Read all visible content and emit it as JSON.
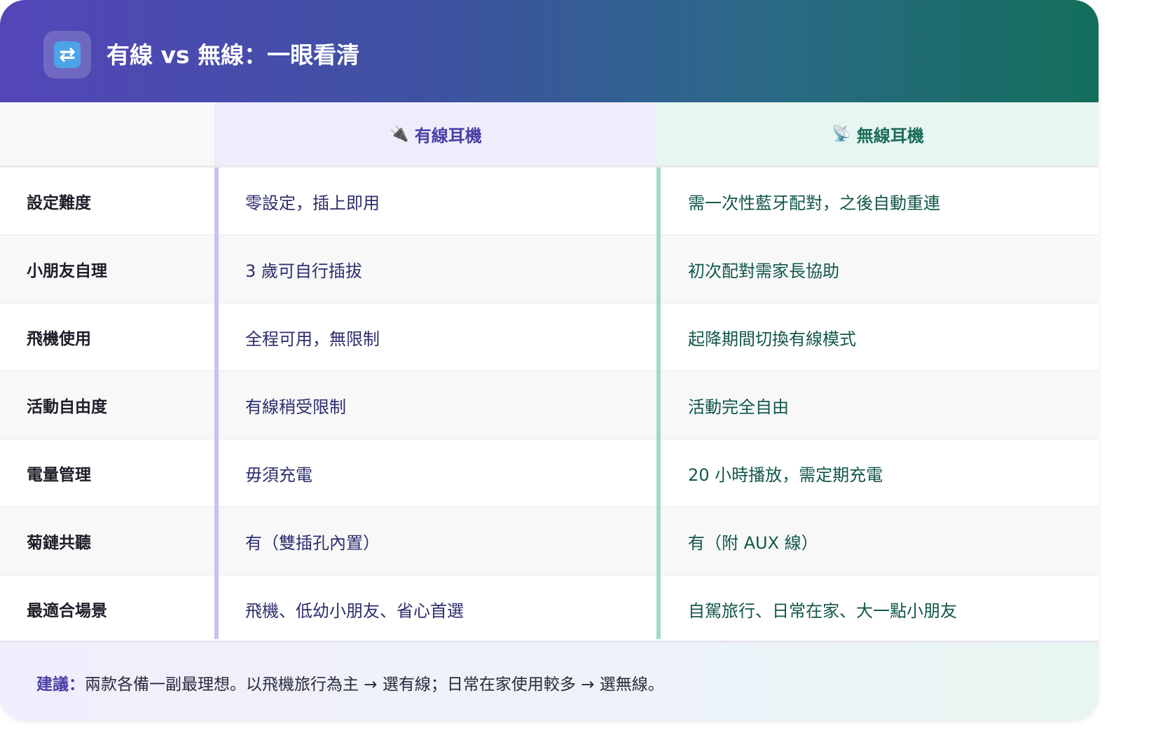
{
  "header": {
    "icon": "arrows-cycle-icon",
    "icon_glyph": "⇄",
    "title": "有線 vs 無線：一眼看清"
  },
  "columns": {
    "wired": {
      "emoji": "🔌",
      "label": "有線耳機",
      "color": "#4a3fa6"
    },
    "wireless": {
      "emoji": "📡",
      "label": "無線耳機",
      "color": "#1b6c5a"
    }
  },
  "rows": [
    {
      "label": "設定難度",
      "wired": "零設定，插上即用",
      "wireless": "需一次性藍牙配對，之後自動重連"
    },
    {
      "label": "小朋友自理",
      "wired": "3 歲可自行插拔",
      "wireless": "初次配對需家長協助"
    },
    {
      "label": "飛機使用",
      "wired": "全程可用，無限制",
      "wireless": "起降期間切換有線模式"
    },
    {
      "label": "活動自由度",
      "wired": "有線稍受限制",
      "wireless": "活動完全自由"
    },
    {
      "label": "電量管理",
      "wired": "毋須充電",
      "wireless": "20 小時播放，需定期充電"
    },
    {
      "label": "菊鏈共聽",
      "wired": "有（雙插孔內置）",
      "wireless": "有（附 AUX 線）"
    },
    {
      "label": "最適合場景",
      "wired": "飛機、低幼小朋友、省心首選",
      "wireless": "自駕旅行、日常在家、大一點小朋友"
    }
  ],
  "footer": {
    "key": "建議：",
    "text": "兩款各備一副最理想。以飛機旅行為主 → 選有線；日常在家使用較多 → 選無線。"
  }
}
